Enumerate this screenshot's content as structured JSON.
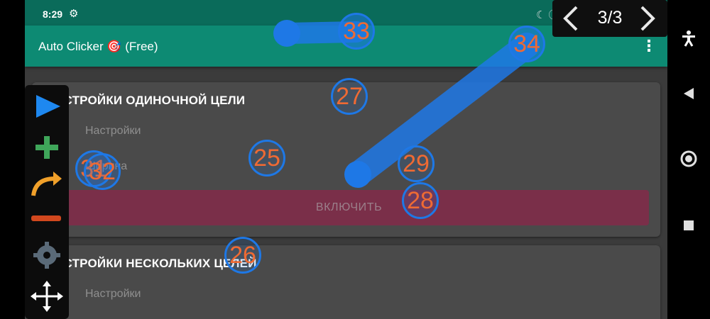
{
  "status_bar": {
    "time": "8:29",
    "gear_icon": "gear-icon",
    "right_icons": "☾ ⓘ"
  },
  "app_bar": {
    "title": "Auto Clicker 🎯 (Free)",
    "menu_icon": "more-vert-icon"
  },
  "card_single": {
    "title": "НАСТРОЙКИ ОДИНОЧНОЙ ЦЕЛИ",
    "rows": [
      {
        "icon": "gear-icon",
        "label": "Настройки"
      },
      {
        "icon": "radio-icon",
        "label": "Ширина"
      }
    ],
    "button_label": "ВКЛЮЧИТЬ"
  },
  "card_multi": {
    "title": "НАСТРОЙКИ НЕСКОЛЬКИХ ЦЕЛЕЙ",
    "rows": [
      {
        "icon": "gear-icon",
        "label": "Настройки"
      }
    ]
  },
  "toolbar": [
    "play-icon",
    "add-icon",
    "swipe-arrow-icon",
    "remove-icon",
    "gear-icon",
    "move-icon"
  ],
  "page_nav": {
    "counter": "3/3",
    "prev_icon": "chevron-left-icon",
    "next_icon": "chevron-right-icon"
  },
  "nav_bar": [
    "accessibility-icon",
    "back-icon",
    "home-icon",
    "recents-icon"
  ],
  "markers": {
    "m25": "25",
    "m26": "26",
    "m27": "27",
    "m28": "28",
    "m29": "29",
    "m31": "31",
    "m32": "32",
    "m33": "33",
    "m34": "34"
  },
  "colors": {
    "accent_teal": "#0d8a73",
    "marker_blue": "#1e78e6",
    "marker_text": "#ef6a33",
    "button_bg": "#7a2f49"
  }
}
